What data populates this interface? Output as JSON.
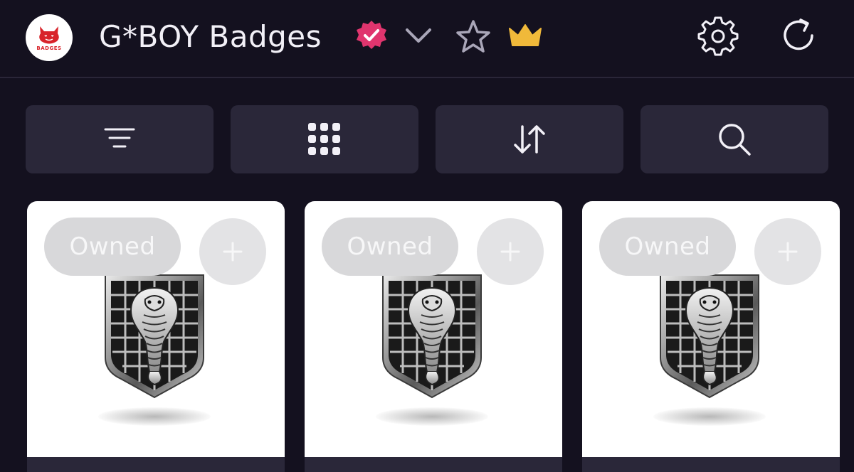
{
  "header": {
    "logo_text": "BADGES",
    "title": "G*BOY Badges",
    "icons": {
      "verified": "verified-badge-icon",
      "chevron": "chevron-down-icon",
      "star": "star-outline-icon",
      "crown": "crown-icon",
      "settings": "gear-icon",
      "refresh": "refresh-icon"
    }
  },
  "toolbar": {
    "buttons": [
      {
        "icon": "filter-icon"
      },
      {
        "icon": "grid-view-icon"
      },
      {
        "icon": "sort-icon"
      },
      {
        "icon": "search-icon"
      }
    ]
  },
  "cards": [
    {
      "status": "Owned",
      "add_label": "+",
      "image": "cobra-shield-badge"
    },
    {
      "status": "Owned",
      "add_label": "+",
      "image": "cobra-shield-badge"
    },
    {
      "status": "Owned",
      "add_label": "+",
      "image": "cobra-shield-badge"
    }
  ],
  "colors": {
    "background": "#14111f",
    "toolbar_button": "#2a2739",
    "verified": "#e0356e",
    "crown": "#f0b93a",
    "logo_red": "#d8232a"
  }
}
